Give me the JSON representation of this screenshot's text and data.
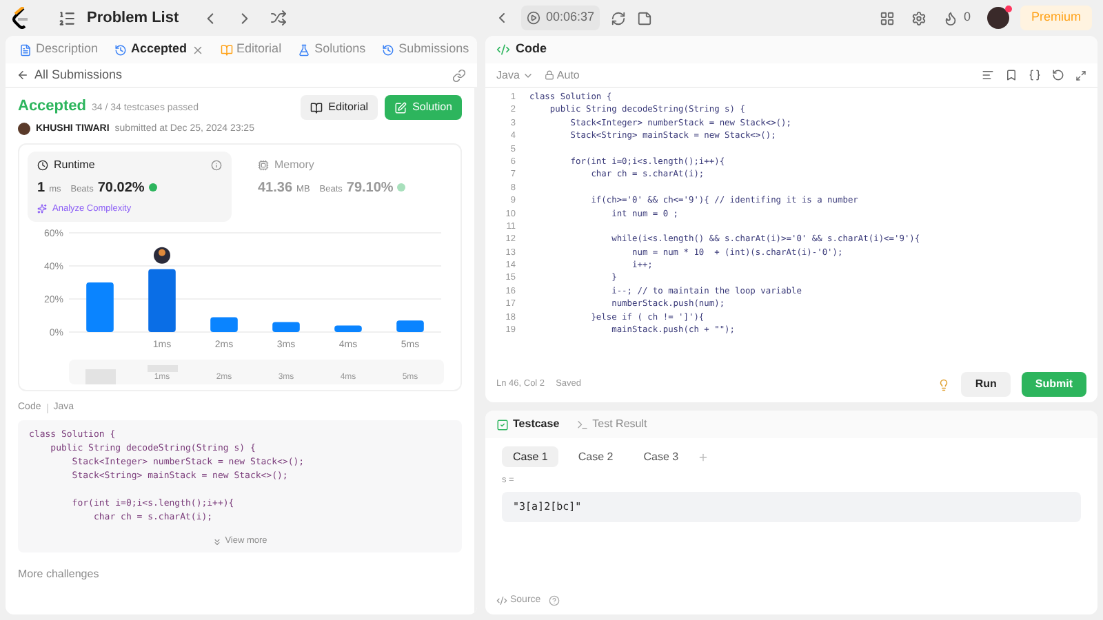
{
  "topbar": {
    "title": "Problem List",
    "timer": "00:06:37",
    "streak": "0",
    "premium": "Premium"
  },
  "left_tabs": [
    {
      "label": "Description",
      "selected": false,
      "closable": false
    },
    {
      "label": "Accepted",
      "selected": true,
      "closable": true
    },
    {
      "label": "Editorial",
      "selected": false,
      "closable": false
    },
    {
      "label": "Solutions",
      "selected": false,
      "closable": false
    },
    {
      "label": "Submissions",
      "selected": false,
      "closable": false
    }
  ],
  "back_link": "All Submissions",
  "submission": {
    "status": "Accepted",
    "testcases": "34 / 34 testcases passed",
    "author": "KHUSHI TIWARI",
    "submitted": "submitted at Dec 25, 2024 23:25",
    "buttons": [
      "Editorial",
      "Solution"
    ]
  },
  "stats": [
    {
      "title": "Runtime",
      "value": "1",
      "unit": "ms",
      "beats_label": "Beats",
      "beats": "70.02%",
      "selected": true
    },
    {
      "title": "Memory",
      "value": "41.36",
      "unit": "MB",
      "beats_label": "Beats",
      "beats": "79.10%",
      "selected": false
    }
  ],
  "analyze": "Analyze Complexity",
  "chart_data": {
    "type": "bar",
    "x": [
      0,
      1,
      2,
      3,
      4,
      5
    ],
    "values": [
      30,
      38,
      9,
      6,
      4,
      7
    ],
    "xlim": [
      -0.5,
      5.5
    ],
    "ylim": [
      0,
      60
    ],
    "yticks": [
      {
        "value": 0,
        "label": "0%"
      },
      {
        "value": 20,
        "label": "20%"
      },
      {
        "value": 40,
        "label": "40%"
      },
      {
        "value": 60,
        "label": "60%"
      }
    ],
    "xticks": [
      {
        "value": 1,
        "label": "1ms"
      },
      {
        "value": 2,
        "label": "2ms"
      },
      {
        "value": 3,
        "label": "3ms"
      },
      {
        "value": 4,
        "label": "4ms"
      },
      {
        "value": 5,
        "label": "5ms"
      }
    ]
  },
  "navigator": {
    "labels": [
      "1ms",
      "2ms",
      "3ms",
      "4ms",
      "5ms"
    ]
  },
  "code_preview": {
    "label": "Code",
    "language": "Java",
    "lines": [
      {
        "kind": "code",
        "text": "class Solution {"
      },
      {
        "kind": "code",
        "text": "    public String decodeString(String s) {"
      },
      {
        "kind": "code",
        "text": "        Stack<Integer> numberStack = new Stack<>();"
      },
      {
        "kind": "code",
        "text": "        Stack<String> mainStack = new Stack<>();"
      },
      {
        "kind": "blank"
      },
      {
        "kind": "code",
        "text": "        for(int i=0;i<s.length();i++){"
      },
      {
        "kind": "code",
        "text": "            char ch = s.charAt(i);"
      }
    ],
    "view_more": "View more"
  },
  "more": "More challenges",
  "editor": {
    "title": "Code",
    "language": "Java",
    "mode": "Auto",
    "lines": [
      {
        "number": "1",
        "text": "class Solution {"
      },
      {
        "number": "2",
        "text": "    public String decodeString(String s) {"
      },
      {
        "number": "3",
        "text": "        Stack<Integer> numberStack = new Stack<>();"
      },
      {
        "number": "4",
        "text": "        Stack<String> mainStack = new Stack<>();"
      },
      {
        "number": "5"
      },
      {
        "number": "6",
        "text": "        for(int i=0;i<s.length();i++){"
      },
      {
        "number": "7",
        "text": "            char ch = s.charAt(i);"
      },
      {
        "number": "8"
      },
      {
        "number": "9",
        "text": "            if(ch>='0' && ch<='9'){ // identifing it is a number"
      },
      {
        "number": "10",
        "text": "                int num = 0 ;"
      },
      {
        "number": "11"
      },
      {
        "number": "12",
        "text": "                while(i<s.length() && s.charAt(i)>='0' && s.charAt(i)<='9'){"
      },
      {
        "number": "13",
        "text": "                    num = num * 10  + (int)(s.charAt(i)-'0');"
      },
      {
        "number": "14",
        "text": "                    i++;"
      },
      {
        "number": "15",
        "text": "                }"
      },
      {
        "number": "16",
        "text": "                i--; // to maintain the loop variable"
      },
      {
        "number": "17",
        "text": "                numberStack.push(num);"
      },
      {
        "number": "18",
        "text": "            }else if ( ch != ']'){"
      },
      {
        "number": "19",
        "text": "                mainStack.push(ch + \"\");"
      }
    ],
    "status": "Ln 46, Col 2",
    "saved": "Saved",
    "run": "Run",
    "submit": "Submit"
  },
  "bottom_tabs": [
    {
      "label": "Testcase",
      "selected": true
    },
    {
      "label": "Test Result",
      "selected": false
    }
  ],
  "cases": [
    {
      "label": "Case 1",
      "selected": true
    },
    {
      "label": "Case 2",
      "selected": false
    },
    {
      "label": "Case 3",
      "selected": false
    }
  ],
  "input": {
    "label": "s =",
    "value": "\"3[a]2[bc]\""
  },
  "source": "Source"
}
